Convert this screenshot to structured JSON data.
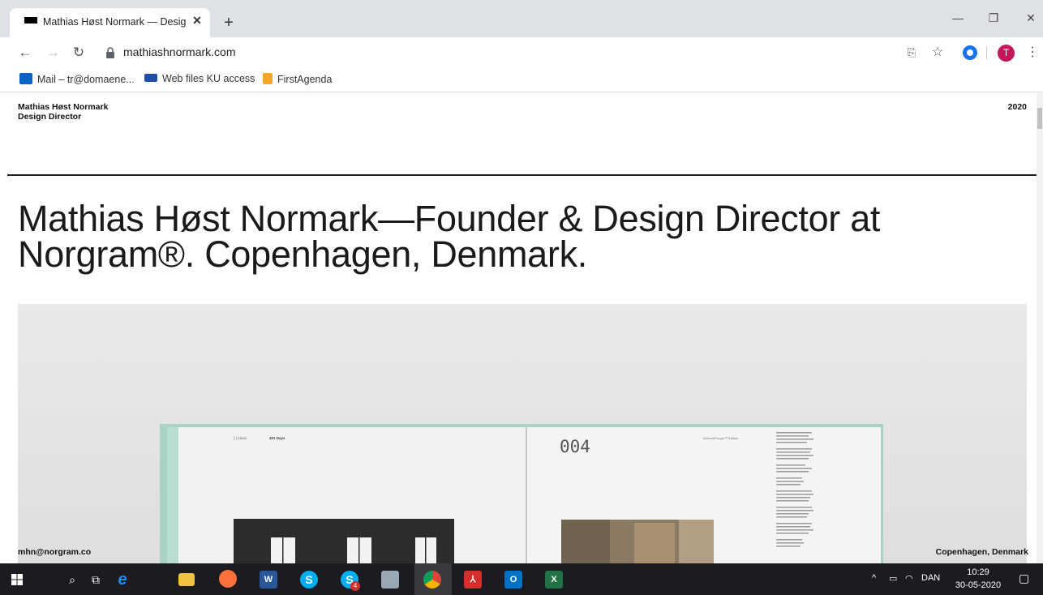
{
  "browser": {
    "tab_title": "Mathias Høst Normark — Design D",
    "tab_close": "✕",
    "new_tab": "+",
    "url": "mathiashnormark.com",
    "bookmarks": [
      {
        "label": "Mail – tr@domaene...",
        "color": "#0a64c8"
      },
      {
        "label": "Web files KU access",
        "color": "#1f4fa3"
      },
      {
        "label": "FirstAgenda",
        "color": "#f5a623"
      }
    ],
    "avatar_letter": "T",
    "accent": "#1a73e8"
  },
  "site": {
    "name_line1": "Mathias Høst Normark",
    "name_line2": "Design Director",
    "year": "2020",
    "headline_line1": "Mathias Høst Normark—Founder & Design Director at",
    "headline_line2": "Norgram®. Copenhagen, Denmark.",
    "email": "mhn@norgram.co",
    "location": "Copenhagen, Denmark",
    "book": {
      "left_small_1": "[ ] Ideas",
      "left_small_2": "401 Days",
      "page_number": "004",
      "right_small": "#AlmostForgot™ Edition"
    }
  },
  "taskbar": {
    "tray_lang": "DAN",
    "time": "10:29",
    "date": "30-05-2020",
    "skype_badge": "4"
  }
}
